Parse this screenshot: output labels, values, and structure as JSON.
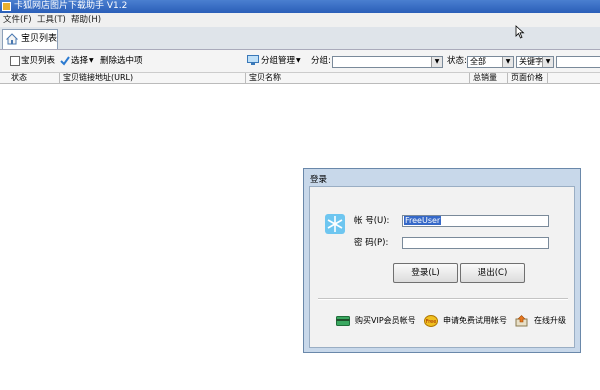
{
  "window": {
    "title": "卡狐网店图片下载助手 V1.2"
  },
  "menu": {
    "items": [
      "文件(F)",
      "工具(T)",
      "帮助(H)"
    ]
  },
  "tabs": [
    {
      "label": "宝贝列表"
    }
  ],
  "toolbar": {
    "select_all_label": "宝贝列表",
    "select_label": "选择",
    "delete_label": "删除选中项",
    "group_manage_label": "分组管理",
    "group_label": "分组:",
    "group_value": "",
    "status_label": "状态:",
    "status_value": "全部",
    "keyword_value": "关键字",
    "search_value": ""
  },
  "grid": {
    "columns": [
      "状态",
      "宝贝链接地址(URL)",
      "宝贝名称",
      "总销量",
      "页面价格"
    ]
  },
  "login": {
    "title": "登录",
    "account_label": "帐  号(U):",
    "account_value": "FreeUser",
    "password_label": "密  码(P):",
    "password_value": "",
    "login_button": "登录(L)",
    "exit_button": "退出(C)",
    "links": [
      "购买VIP会员帐号",
      "申请免费试用帐号",
      "在线升级"
    ]
  },
  "colors": {
    "titlebar": "#2a5eb8",
    "dialog_frame": "#c8d8ea",
    "selection": "#3568c8"
  }
}
